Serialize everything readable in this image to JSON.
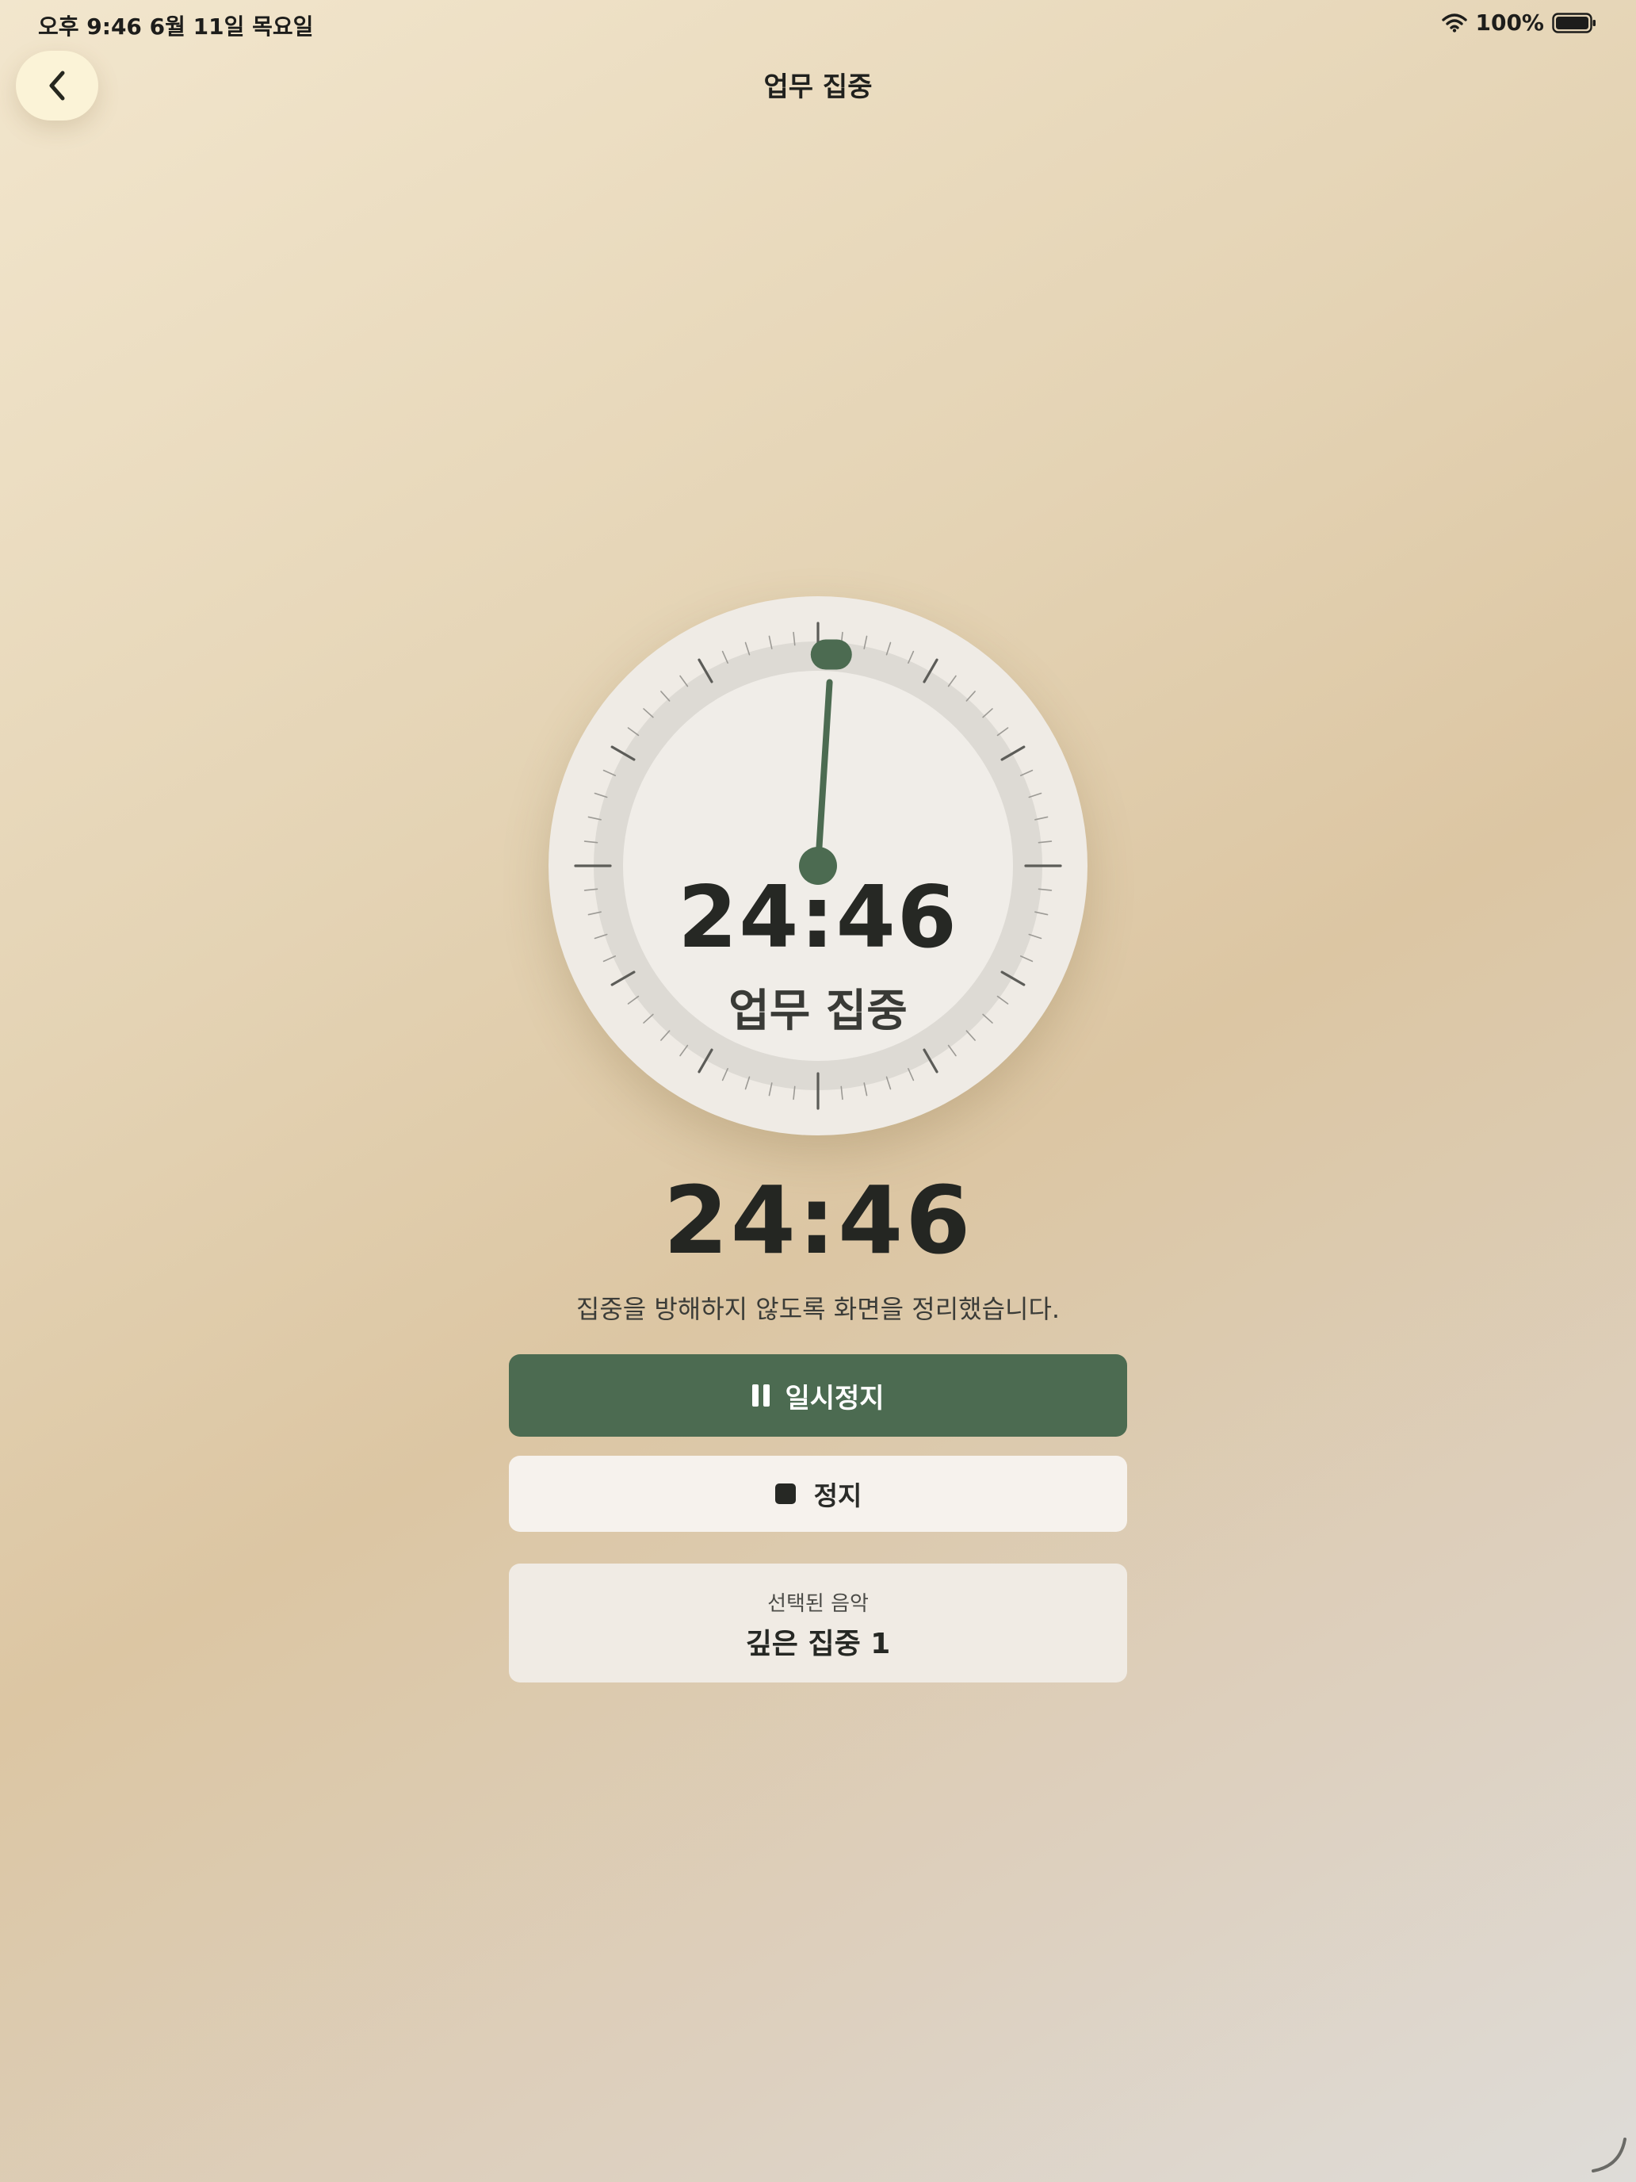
{
  "status_bar": {
    "time_date": "오후 9:46   6월 11일 목요일",
    "battery": "100%",
    "icons": [
      "wifi-icon",
      "battery-icon"
    ]
  },
  "nav": {
    "title": "업무 집중",
    "back_icon": "chevron-left-icon"
  },
  "dial": {
    "time": "24:46",
    "label": "업무 집중",
    "remaining_fraction": 0.99,
    "accent_color": "#4c6b51"
  },
  "timer": {
    "time": "24:46",
    "message": "집중을 방해하지 않도록 화면을 정리했습니다."
  },
  "controls": {
    "pause_label": "일시정지",
    "pause_icon": "pause-icon",
    "stop_label": "정지",
    "stop_icon": "stop-icon",
    "primary_color": "#4c6b51"
  },
  "music": {
    "caption": "선택된 음악",
    "title": "깊은 집중 1"
  }
}
